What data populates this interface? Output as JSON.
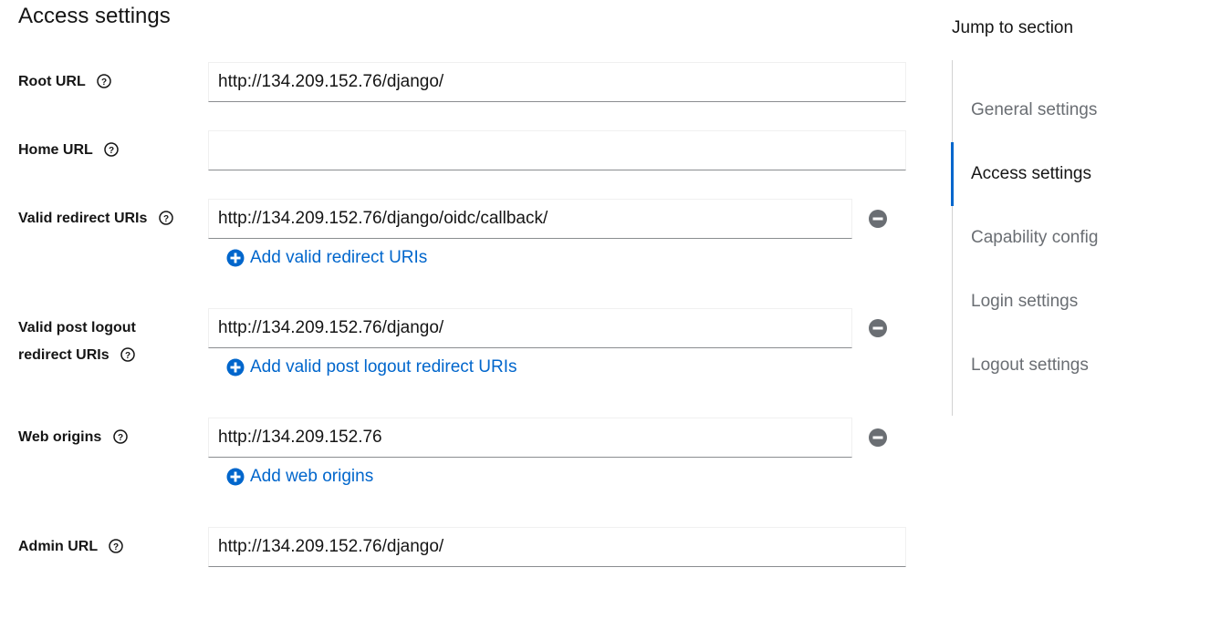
{
  "section": {
    "title": "Access settings"
  },
  "fields": {
    "root_url": {
      "label": "Root URL",
      "value": "http://134.209.152.76/django/"
    },
    "home_url": {
      "label": "Home URL",
      "value": ""
    },
    "valid_redirect_uris": {
      "label": "Valid redirect URIs",
      "value": "http://134.209.152.76/django/oidc/callback/",
      "add_label": "Add valid redirect URIs"
    },
    "valid_post_logout": {
      "label_line1": "Valid post logout",
      "label_line2": "redirect URIs",
      "value": "http://134.209.152.76/django/",
      "add_label": "Add valid post logout redirect URIs"
    },
    "web_origins": {
      "label": "Web origins",
      "value": "http://134.209.152.76",
      "add_label": "Add web origins"
    },
    "admin_url": {
      "label": "Admin URL",
      "value": "http://134.209.152.76/django/"
    }
  },
  "jump": {
    "title": "Jump to section",
    "items": [
      {
        "label": "General settings",
        "active": false
      },
      {
        "label": "Access settings",
        "active": true
      },
      {
        "label": "Capability config",
        "active": false
      },
      {
        "label": "Login settings",
        "active": false
      },
      {
        "label": "Logout settings",
        "active": false
      }
    ]
  },
  "icons": {
    "help": "help-circle-icon",
    "remove": "minus-circle-icon",
    "add": "plus-circle-icon"
  },
  "colors": {
    "link": "#0066cc",
    "remove_icon": "#6a6e73",
    "active_indicator": "#0066cc"
  }
}
